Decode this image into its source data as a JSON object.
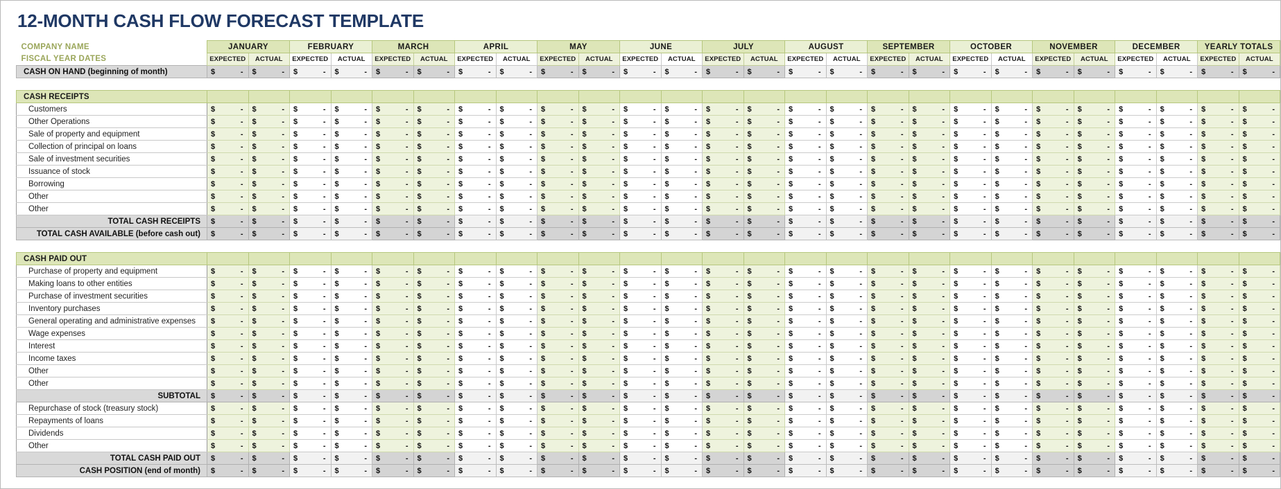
{
  "document": {
    "title": "12-MONTH CASH FLOW FORECAST TEMPLATE",
    "title_color": "#1f3864"
  },
  "meta_labels": {
    "company_name": "COMPANY NAME",
    "fiscal_year_dates": "FISCAL YEAR DATES"
  },
  "columns": {
    "months": [
      "JANUARY",
      "FEBRUARY",
      "MARCH",
      "APRIL",
      "MAY",
      "JUNE",
      "JULY",
      "AUGUST",
      "SEPTEMBER",
      "OCTOBER",
      "NOVEMBER",
      "DECEMBER",
      "YEARLY TOTALS"
    ],
    "sub_headers": [
      "EXPECTED",
      "ACTUAL"
    ]
  },
  "cell": {
    "currency_symbol": "$",
    "empty_value": "-"
  },
  "colors": {
    "section_green": "#dde6b8",
    "cell_green": "#eef3dd",
    "total_grey": "#d4d4d4",
    "meta_olive": "#9aa65a",
    "title_navy": "#1f3864"
  },
  "rows": [
    {
      "id": "cash-on-hand",
      "label": "CASH ON HAND (beginning of month)",
      "style": "total",
      "align": "left"
    },
    {
      "id": "spacer-1",
      "style": "spacer"
    },
    {
      "id": "cash-receipts-header",
      "label": "CASH RECEIPTS",
      "style": "section"
    },
    {
      "id": "customers",
      "label": "Customers",
      "style": "item"
    },
    {
      "id": "other-operations",
      "label": "Other Operations",
      "style": "item"
    },
    {
      "id": "sale-of-property-and-equipment",
      "label": "Sale of property and equipment",
      "style": "item"
    },
    {
      "id": "collection-of-principal-on-loans",
      "label": "Collection of principal on loans",
      "style": "item"
    },
    {
      "id": "sale-of-investment-securities",
      "label": "Sale of investment securities",
      "style": "item"
    },
    {
      "id": "issuance-of-stock",
      "label": "Issuance of stock",
      "style": "item"
    },
    {
      "id": "borrowing",
      "label": "Borrowing",
      "style": "item"
    },
    {
      "id": "receipts-other-1",
      "label": "Other",
      "style": "item"
    },
    {
      "id": "receipts-other-2",
      "label": "Other",
      "style": "item"
    },
    {
      "id": "total-cash-receipts",
      "label": "TOTAL CASH RECEIPTS",
      "style": "total",
      "align": "right"
    },
    {
      "id": "total-cash-available",
      "label": "TOTAL CASH AVAILABLE (before cash out)",
      "style": "total",
      "align": "right"
    },
    {
      "id": "spacer-2",
      "style": "spacer"
    },
    {
      "id": "cash-paid-out-header",
      "label": "CASH PAID OUT",
      "style": "section"
    },
    {
      "id": "purchase-of-property-and-equipment",
      "label": "Purchase of property and equipment",
      "style": "item"
    },
    {
      "id": "making-loans-to-other-entities",
      "label": "Making loans to other entities",
      "style": "item"
    },
    {
      "id": "purchase-of-investment-securities",
      "label": "Purchase of investment securities",
      "style": "item"
    },
    {
      "id": "inventory-purchases",
      "label": "Inventory purchases",
      "style": "item"
    },
    {
      "id": "general-operating-and-administrative-expenses",
      "label": "General operating and administrative expenses",
      "style": "item"
    },
    {
      "id": "wage-expenses",
      "label": "Wage expenses",
      "style": "item"
    },
    {
      "id": "interest",
      "label": "Interest",
      "style": "item"
    },
    {
      "id": "income-taxes",
      "label": "Income taxes",
      "style": "item"
    },
    {
      "id": "paid-out-other-1",
      "label": "Other",
      "style": "item"
    },
    {
      "id": "paid-out-other-2",
      "label": "Other",
      "style": "item"
    },
    {
      "id": "subtotal",
      "label": "SUBTOTAL",
      "style": "total",
      "align": "right"
    },
    {
      "id": "repurchase-of-stock",
      "label": "Repurchase of stock (treasury stock)",
      "style": "item"
    },
    {
      "id": "repayments-of-loans",
      "label": "Repayments of loans",
      "style": "item"
    },
    {
      "id": "dividends",
      "label": "Dividends",
      "style": "item"
    },
    {
      "id": "paid-out-other-3",
      "label": "Other",
      "style": "item"
    },
    {
      "id": "total-cash-paid-out",
      "label": "TOTAL CASH PAID OUT",
      "style": "total",
      "align": "right"
    },
    {
      "id": "cash-position",
      "label": "CASH POSITION (end of month)",
      "style": "total",
      "align": "right"
    }
  ]
}
